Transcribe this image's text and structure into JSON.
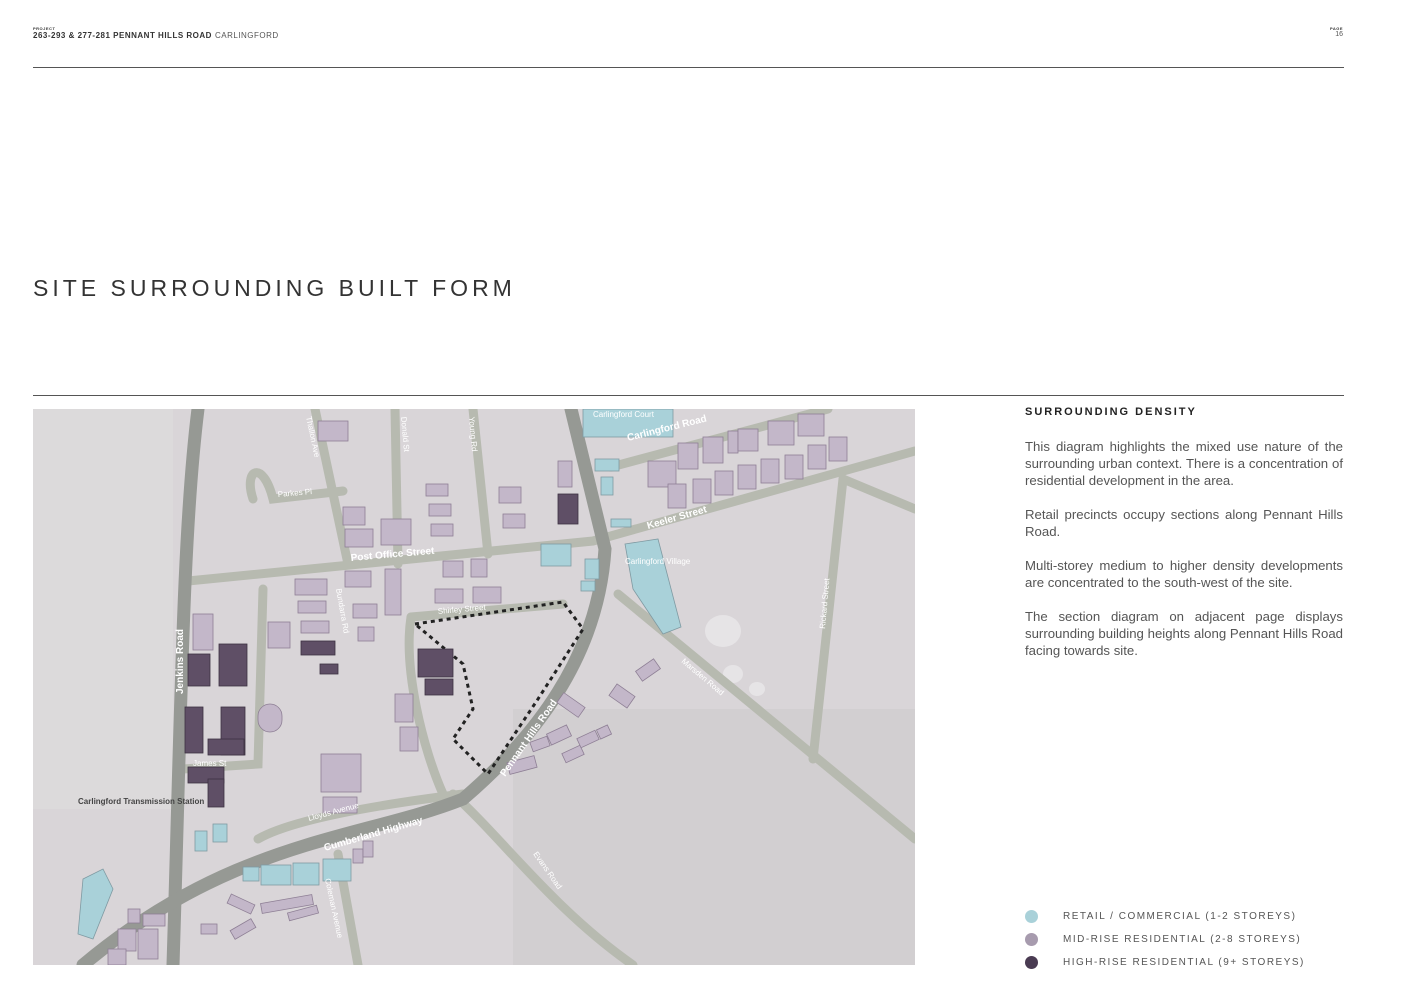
{
  "header": {
    "project_tag": "PROJECT",
    "project_name": "263-293 & 277-281 PENNANT HILLS ROAD",
    "project_suburb": "CARLINGFORD",
    "page_tag": "PAGE",
    "page_number": "16"
  },
  "title": "SITE SURROUNDING BUILT FORM",
  "map": {
    "road_labels": {
      "carlingford_court": "Carlingford Court",
      "carlingford_road": "Carlingford Road",
      "keeler_street": "Keeler Street",
      "post_office_street": "Post Office Street",
      "shirley_street": "Shirley Street",
      "pennant_hills_road": "Pennant Hills Road",
      "jenkins_road": "Jenkins Road",
      "james_st": "James St",
      "lloyds_avenue": "Lloyds Avenue",
      "cumberland_highway": "Cumberland Highway",
      "coleman_avenue": "Coleman Avenue",
      "evans_road": "Evans Road",
      "marsden_road": "Marsden Road",
      "rickard_street": "Rickard Street",
      "carlingford_village": "Carlingford Village",
      "transmission_station": "Carlingford Transmission Station",
      "parkes_pl": "Parkes Pl",
      "donald_st": "Donald St",
      "young_rd": "Young Rd",
      "thallon_ave": "Thallon Ave",
      "bundarra_rd": "Bundarra Rd"
    }
  },
  "sidebar": {
    "heading": "SURROUNDING DENSITY",
    "paragraphs": [
      "This diagram highlights the mixed use nature of the surrounding urban context. There is a concentration of residential development in the area.",
      "Retail precincts occupy sections along Pennant Hills Road.",
      "Multi-storey medium to higher density developments are concentrated to the south-west of the site.",
      "The section diagram on adjacent page displays surrounding building heights along Pennant Hills Road facing towards site."
    ]
  },
  "legend": [
    {
      "label": "RETAIL / COMMERCIAL (1-2 STOREYS)",
      "color": "#a9d1d9"
    },
    {
      "label": "MID-RISE RESIDENTIAL (2-8 STOREYS)",
      "color": "#a79bae"
    },
    {
      "label": "HIGH-RISE RESIDENTIAL (9+ STOREYS)",
      "color": "#4a3b52"
    }
  ],
  "colors": {
    "retail": "#a9d1d9",
    "midrise": "#c3b7c9",
    "highrise": "#5f4f66",
    "road": "#b7bab0",
    "main_road": "#8f928d",
    "map_bg": "#dad6d8"
  }
}
